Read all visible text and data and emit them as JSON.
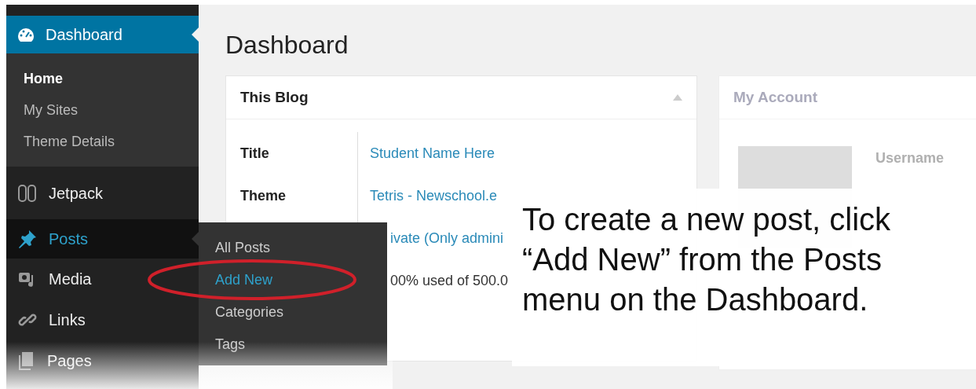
{
  "sidebar": {
    "items": [
      {
        "label": "Dashboard",
        "selected": true,
        "hovered": false,
        "children": [
          {
            "label": "Home",
            "selected": true
          },
          {
            "label": "My Sites",
            "selected": false
          },
          {
            "label": "Theme Details",
            "selected": false
          }
        ]
      },
      {
        "label": "Jetpack",
        "selected": false,
        "hovered": false
      },
      {
        "label": "Posts",
        "selected": false,
        "hovered": true
      },
      {
        "label": "Media",
        "selected": false,
        "hovered": false
      },
      {
        "label": "Links",
        "selected": false,
        "hovered": false
      },
      {
        "label": "Pages",
        "selected": false,
        "hovered": false
      }
    ]
  },
  "flyout": {
    "items": [
      {
        "label": "All Posts",
        "highlighted": false
      },
      {
        "label": "Add New",
        "highlighted": true
      },
      {
        "label": "Categories",
        "highlighted": false
      },
      {
        "label": "Tags",
        "highlighted": false
      }
    ]
  },
  "page_title": "Dashboard",
  "this_blog": {
    "title": "This Blog",
    "expanded": true,
    "rows": [
      {
        "label": "Title",
        "value": "Student Name Here"
      },
      {
        "label": "Theme",
        "value": "Tetris - Newschool.e"
      },
      {
        "value": "ivate (Only admini"
      },
      {
        "value": "00% used of 500.0"
      }
    ]
  },
  "my_account": {
    "title": "My Account",
    "fields": [
      "Username"
    ]
  },
  "callout": {
    "text": "To create a new post, click “Add New” from the Posts menu on the Dashboard."
  }
}
